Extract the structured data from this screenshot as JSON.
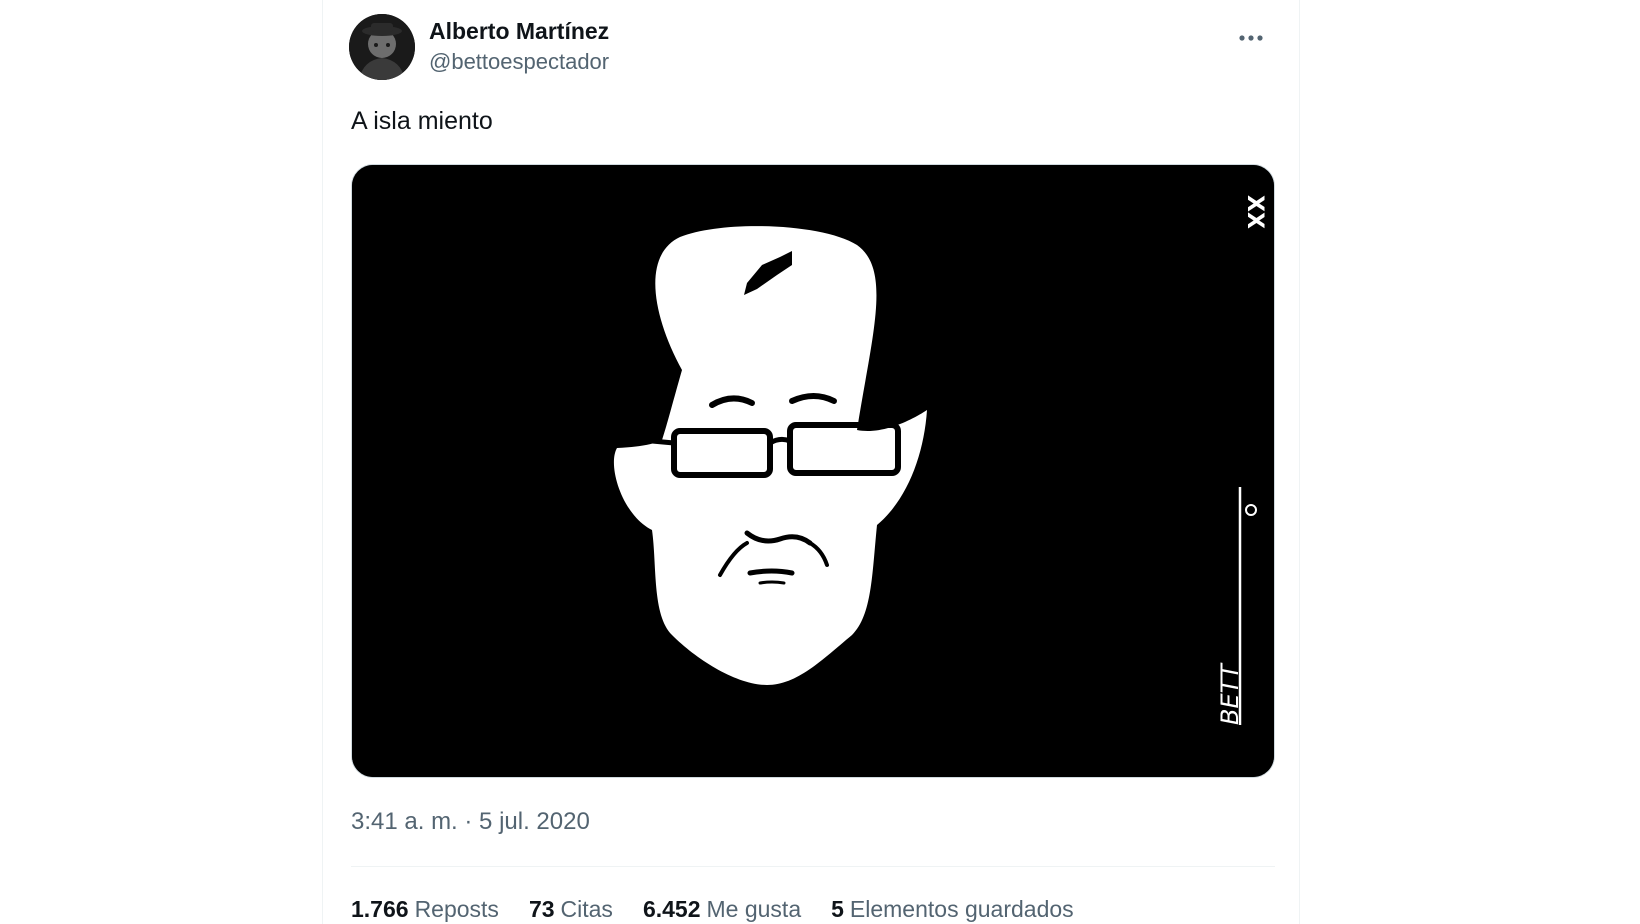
{
  "tweet": {
    "author": {
      "display_name": "Alberto Martínez",
      "handle": "@bettoespectador"
    },
    "text": "A isla miento",
    "timestamp": "3:41 a. m. · 5 jul. 2020",
    "image_signature": "BETT",
    "image_mark": "XX",
    "stats": [
      {
        "count": "1.766",
        "label": "Reposts"
      },
      {
        "count": "73",
        "label": "Citas"
      },
      {
        "count": "6.452",
        "label": "Me gusta"
      },
      {
        "count": "5",
        "label": "Elementos guardados"
      }
    ]
  },
  "icons": {
    "more": "more-options-icon"
  },
  "colors": {
    "text_primary": "#0f1419",
    "text_secondary": "#536471",
    "divider": "#eff3f4",
    "media_background": "#000000"
  }
}
